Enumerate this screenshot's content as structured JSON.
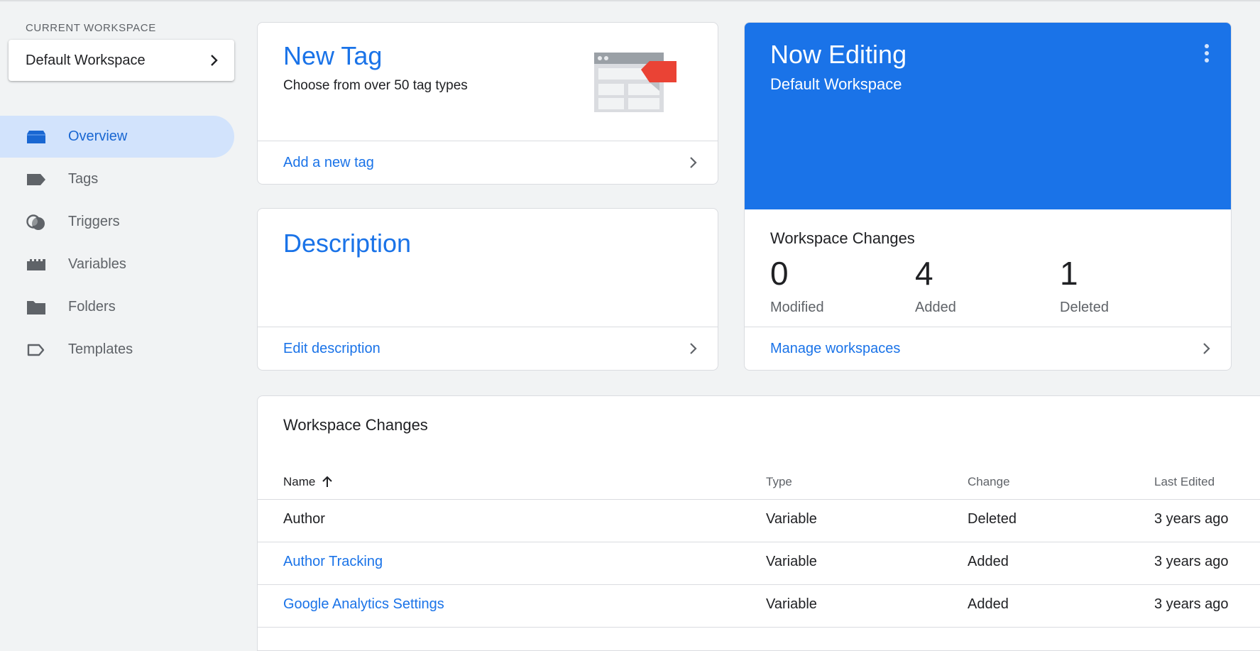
{
  "sidebar": {
    "current_workspace_label": "CURRENT WORKSPACE",
    "workspace_name": "Default Workspace",
    "items": [
      {
        "label": "Overview",
        "icon": "overview-icon",
        "active": true
      },
      {
        "label": "Tags",
        "icon": "tag-icon",
        "active": false
      },
      {
        "label": "Triggers",
        "icon": "trigger-icon",
        "active": false
      },
      {
        "label": "Variables",
        "icon": "variables-icon",
        "active": false
      },
      {
        "label": "Folders",
        "icon": "folder-icon",
        "active": false
      },
      {
        "label": "Templates",
        "icon": "template-icon",
        "active": false
      }
    ]
  },
  "new_tag_card": {
    "title": "New Tag",
    "subtitle": "Choose from over 50 tag types",
    "link": "Add a new tag"
  },
  "description_card": {
    "title": "Description",
    "link": "Edit description"
  },
  "editing_card": {
    "title": "Now Editing",
    "workspace": "Default Workspace",
    "changes_label": "Workspace Changes",
    "stats": [
      {
        "value": "0",
        "label": "Modified"
      },
      {
        "value": "4",
        "label": "Added"
      },
      {
        "value": "1",
        "label": "Deleted"
      }
    ],
    "link": "Manage workspaces"
  },
  "changes_table": {
    "caption": "Workspace Changes",
    "columns": {
      "name": "Name",
      "type": "Type",
      "change": "Change",
      "last_edited": "Last Edited"
    },
    "rows": [
      {
        "name": "Author",
        "type": "Variable",
        "change": "Deleted",
        "last_edited": "3 years ago",
        "is_link": false
      },
      {
        "name": "Author Tracking",
        "type": "Variable",
        "change": "Added",
        "last_edited": "3 years ago",
        "is_link": true
      },
      {
        "name": "Google Analytics Settings",
        "type": "Variable",
        "change": "Added",
        "last_edited": "3 years ago",
        "is_link": true
      }
    ]
  },
  "colors": {
    "accent": "#1a73e8",
    "active_nav_bg": "#d2e3fc",
    "background": "#f1f3f4",
    "tag_red": "#ea4335"
  }
}
